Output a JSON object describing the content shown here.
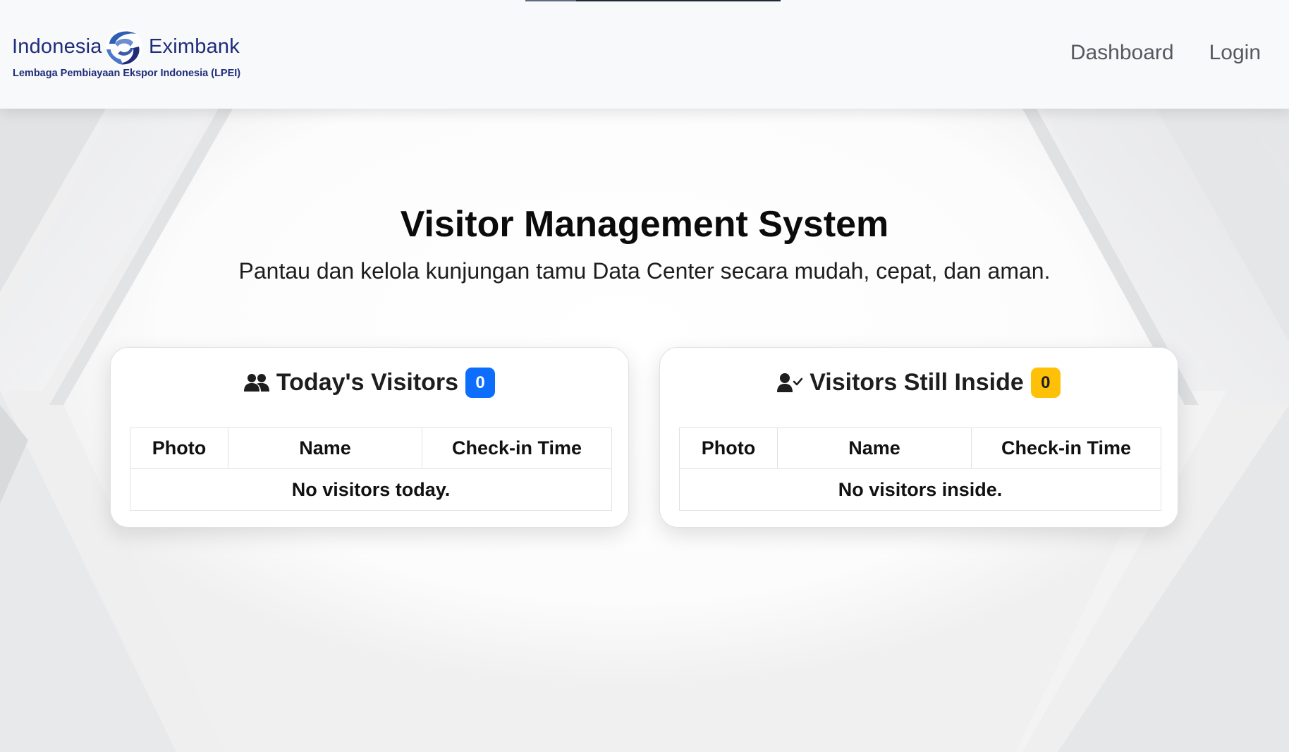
{
  "navbar": {
    "brand": {
      "name_left": "Indonesia",
      "name_right": "Eximbank",
      "subtitle": "Lembaga Pembiayaan Ekspor Indonesia (LPEI)",
      "logo_icon": "eximbank-swirl-logo"
    },
    "links": [
      {
        "label": "Dashboard"
      },
      {
        "label": "Login"
      }
    ]
  },
  "hero": {
    "title": "Visitor Management System",
    "subtitle": "Pantau dan kelola kunjungan tamu Data Center secara mudah, cepat, dan aman."
  },
  "cards": {
    "today": {
      "icon": "users-icon",
      "title": "Today's Visitors",
      "count": "0",
      "badge_color": "#0d6efd",
      "columns": [
        "Photo",
        "Name",
        "Check-in Time"
      ],
      "empty_message": "No visitors today."
    },
    "inside": {
      "icon": "user-check-icon",
      "title": "Visitors Still Inside",
      "count": "0",
      "badge_color": "#ffc107",
      "columns": [
        "Photo",
        "Name",
        "Check-in Time"
      ],
      "empty_message": "No visitors inside."
    }
  },
  "colors": {
    "brand_navy": "#1f2c7a",
    "navbar_bg": "#f8f9fa",
    "badge_blue": "#0d6efd",
    "badge_yellow": "#ffc107"
  }
}
